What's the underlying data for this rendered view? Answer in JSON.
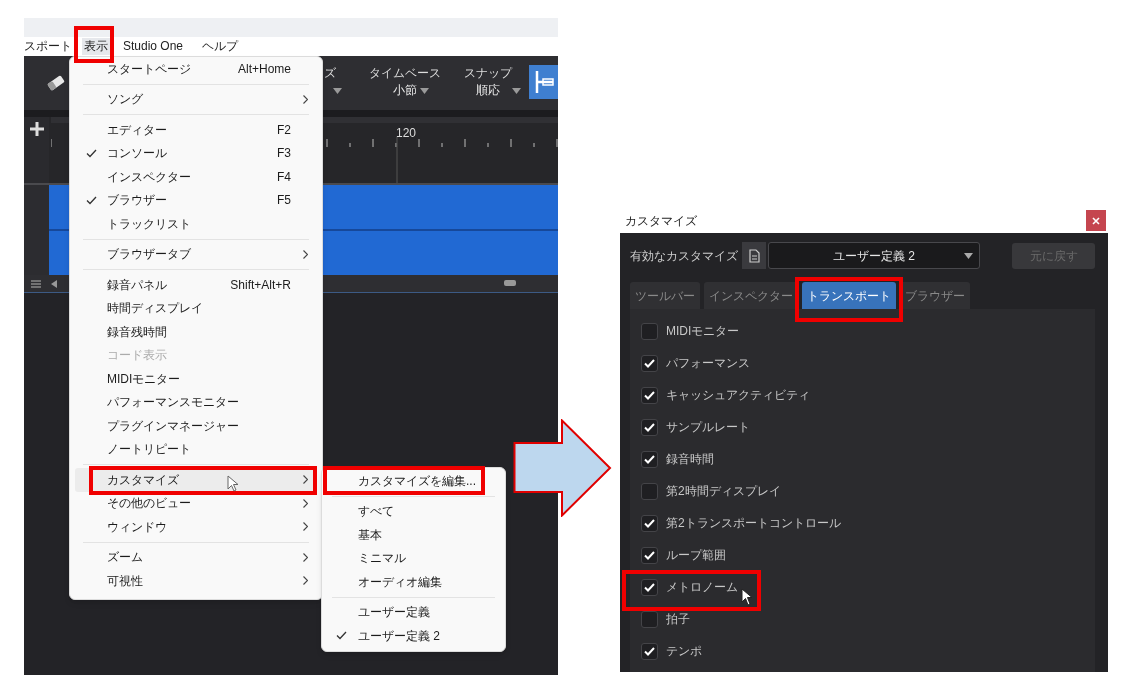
{
  "editor_window": {
    "menu_bar": [
      {
        "label": "スポート",
        "selected": false
      },
      {
        "label": "表示",
        "selected": true
      },
      {
        "label": "Studio One",
        "selected": false
      },
      {
        "label": "ヘルプ",
        "selected": false
      }
    ],
    "toolbar": {
      "cut_label": "ズ",
      "timebase": {
        "label": "タイムベース",
        "value": "小節"
      },
      "snap": {
        "label": "スナップ",
        "value": "順応"
      }
    },
    "ruler": {
      "bar_number": "120"
    },
    "view_menu": [
      {
        "kind": "item",
        "label": "スタートページ",
        "shortcut": "Alt+Home",
        "checked": false,
        "disabled": false,
        "submenu": false,
        "selected": false
      },
      {
        "kind": "separator"
      },
      {
        "kind": "item",
        "label": "ソング",
        "checked": false,
        "disabled": false,
        "submenu": true,
        "selected": false
      },
      {
        "kind": "separator"
      },
      {
        "kind": "item",
        "label": "エディター",
        "shortcut": "F2",
        "checked": false,
        "disabled": false,
        "submenu": false,
        "selected": false
      },
      {
        "kind": "item",
        "label": "コンソール",
        "shortcut": "F3",
        "checked": true,
        "disabled": false,
        "submenu": false,
        "selected": false
      },
      {
        "kind": "item",
        "label": "インスペクター",
        "shortcut": "F4",
        "checked": false,
        "disabled": false,
        "submenu": false,
        "selected": false
      },
      {
        "kind": "item",
        "label": "ブラウザー",
        "shortcut": "F5",
        "checked": true,
        "disabled": false,
        "submenu": false,
        "selected": false
      },
      {
        "kind": "item",
        "label": "トラックリスト",
        "checked": false,
        "disabled": false,
        "submenu": false,
        "selected": false
      },
      {
        "kind": "separator"
      },
      {
        "kind": "item",
        "label": "ブラウザータブ",
        "checked": false,
        "disabled": false,
        "submenu": true,
        "selected": false
      },
      {
        "kind": "separator"
      },
      {
        "kind": "item",
        "label": "録音パネル",
        "shortcut": "Shift+Alt+R",
        "checked": false,
        "disabled": false,
        "submenu": false,
        "selected": false
      },
      {
        "kind": "item",
        "label": "時間ディスプレイ",
        "checked": false,
        "disabled": false,
        "submenu": false,
        "selected": false
      },
      {
        "kind": "item",
        "label": "録音残時間",
        "checked": false,
        "disabled": false,
        "submenu": false,
        "selected": false
      },
      {
        "kind": "item",
        "label": "コード表示",
        "checked": false,
        "disabled": true,
        "submenu": false,
        "selected": false
      },
      {
        "kind": "item",
        "label": "MIDIモニター",
        "checked": false,
        "disabled": false,
        "submenu": false,
        "selected": false
      },
      {
        "kind": "item",
        "label": "パフォーマンスモニター",
        "checked": false,
        "disabled": false,
        "submenu": false,
        "selected": false
      },
      {
        "kind": "item",
        "label": "プラグインマネージャー",
        "checked": false,
        "disabled": false,
        "submenu": false,
        "selected": false
      },
      {
        "kind": "item",
        "label": "ノートリピート",
        "checked": false,
        "disabled": false,
        "submenu": false,
        "selected": false
      },
      {
        "kind": "separator"
      },
      {
        "kind": "item",
        "label": "カスタマイズ",
        "checked": false,
        "disabled": false,
        "submenu": true,
        "selected": true
      },
      {
        "kind": "item",
        "label": "その他のビュー",
        "checked": false,
        "disabled": false,
        "submenu": true,
        "selected": false
      },
      {
        "kind": "item",
        "label": "ウィンドウ",
        "checked": false,
        "disabled": false,
        "submenu": true,
        "selected": false
      },
      {
        "kind": "separator"
      },
      {
        "kind": "item",
        "label": "ズーム",
        "checked": false,
        "disabled": false,
        "submenu": true,
        "selected": false
      },
      {
        "kind": "item",
        "label": "可視性",
        "checked": false,
        "disabled": false,
        "submenu": true,
        "selected": false
      }
    ],
    "customize_submenu": [
      {
        "kind": "item",
        "label": "カスタマイズを編集...",
        "checked": false,
        "disabled": false,
        "submenu": false,
        "selected": false
      },
      {
        "kind": "separator"
      },
      {
        "kind": "item",
        "label": "すべて",
        "checked": false,
        "disabled": false,
        "submenu": false,
        "selected": false
      },
      {
        "kind": "item",
        "label": "基本",
        "checked": false,
        "disabled": false,
        "submenu": false,
        "selected": false
      },
      {
        "kind": "item",
        "label": "ミニマル",
        "checked": false,
        "disabled": false,
        "submenu": false,
        "selected": false
      },
      {
        "kind": "item",
        "label": "オーディオ編集",
        "checked": false,
        "disabled": false,
        "submenu": false,
        "selected": false
      },
      {
        "kind": "separator"
      },
      {
        "kind": "item",
        "label": "ユーザー定義",
        "checked": false,
        "disabled": false,
        "submenu": false,
        "selected": false
      },
      {
        "kind": "item",
        "label": "ユーザー定義 2",
        "checked": true,
        "disabled": false,
        "submenu": false,
        "selected": false
      }
    ]
  },
  "customize_dialog": {
    "title": "カスタマイズ",
    "active_label": "有効なカスタマイズ",
    "active_value": "ユーザー定義 2",
    "revert_button": {
      "label": "元に戻す",
      "disabled": true
    },
    "tabs": [
      {
        "label": "ツールバー",
        "selected": false
      },
      {
        "label": "インスペクター",
        "selected": false
      },
      {
        "label": "トランスポート",
        "selected": true
      },
      {
        "label": "ブラウザー",
        "selected": false
      }
    ],
    "options": [
      {
        "label": "MIDIモニター",
        "checked": false
      },
      {
        "label": "パフォーマンス",
        "checked": true
      },
      {
        "label": "キャッシュアクティビティ",
        "checked": true
      },
      {
        "label": "サンプルレート",
        "checked": true
      },
      {
        "label": "録音時間",
        "checked": true
      },
      {
        "label": "第2時間ディスプレイ",
        "checked": false
      },
      {
        "label": "第2トランスポートコントロール",
        "checked": true
      },
      {
        "label": "ループ範囲",
        "checked": true
      },
      {
        "label": "メトロノーム",
        "checked": true
      },
      {
        "label": "拍子",
        "checked": false
      },
      {
        "label": "テンポ",
        "checked": true
      }
    ]
  }
}
